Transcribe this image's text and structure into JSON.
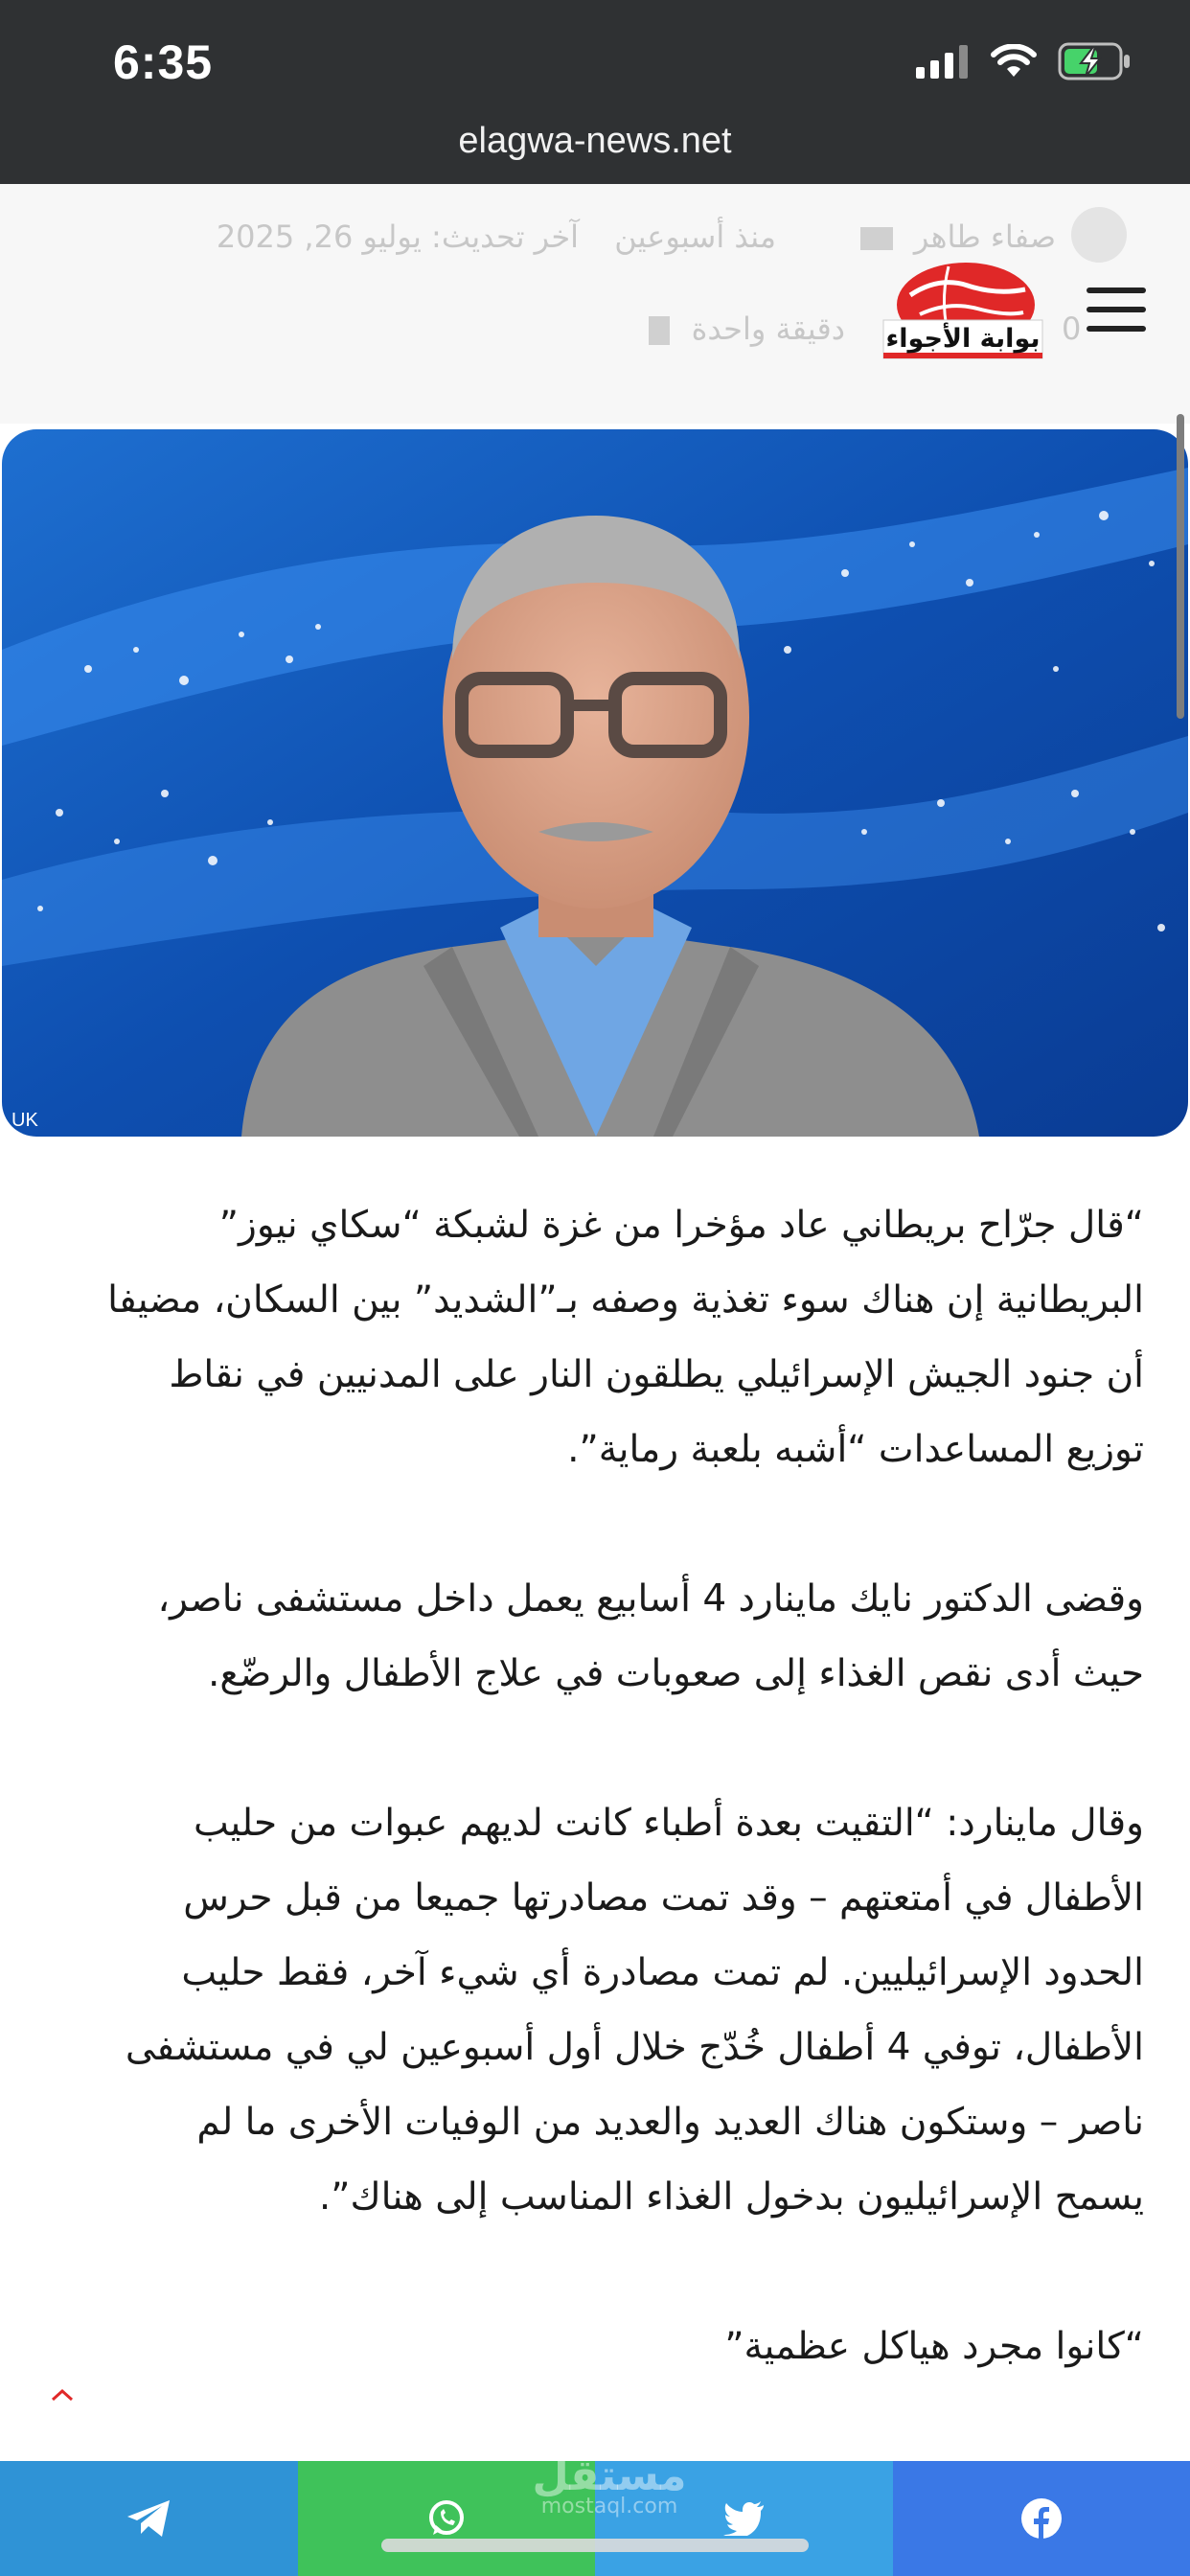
{
  "status": {
    "time": "6:35",
    "url": "elagwa-news.net"
  },
  "header": {
    "author": "صفاء طاهر",
    "published": "منذ أسبوعين",
    "updated": "آخر تحديث: يوليو 26, 2025",
    "read_time": "دقيقة واحدة",
    "count": "0",
    "logo_text": "بوابة الأجواء"
  },
  "hero": {
    "caption": "UK"
  },
  "article": {
    "paragraphs": [
      "“قال جرّاح بريطاني عاد مؤخرا من غزة لشبكة “سكاي نيوز” البريطانية إن هناك سوء تغذية وصفه بـ”الشديد” بين السكان، مضيفا أن جنود الجيش الإسرائيلي يطلقون النار على المدنيين في نقاط توزيع المساعدات “أشبه بلعبة رماية”.",
      "وقضى الدكتور نايك ماينارد 4 أسابيع يعمل داخل مستشفى ناصر، حيث أدى نقص الغذاء إلى صعوبات في علاج الأطفال والرضّع.",
      "وقال ماينارد: “التقيت بعدة أطباء كانت لديهم عبوات من حليب الأطفال في أمتعتهم – وقد تمت مصادرتها جميعا من قبل حرس الحدود الإسرائيليين. لم تمت مصادرة أي شيء آخر، فقط حليب الأطفال، توفي 4 أطفال خُدّج خلال أول أسبوعين لي في مستشفى ناصر – وستكون هناك العديد والعديد من الوفيات الأخرى ما لم يسمح الإسرائيليون بدخول الغذاء المناسب إلى هناك”.",
      "“كانوا مجرد هياكل عظمية”"
    ]
  },
  "share": {
    "buttons": [
      {
        "icon": "telegram-icon",
        "color": "#2f93d6"
      },
      {
        "icon": "whatsapp-icon",
        "color": "#3fc25a"
      },
      {
        "icon": "twitter-icon",
        "color": "#3aa2e4"
      },
      {
        "icon": "facebook-icon",
        "color": "#3a78e6"
      }
    ],
    "watermark": "مستقل",
    "watermark_sub": "mostaql.com"
  },
  "colors": {
    "statusbar": "#2f3133",
    "accent": "#e02828"
  }
}
